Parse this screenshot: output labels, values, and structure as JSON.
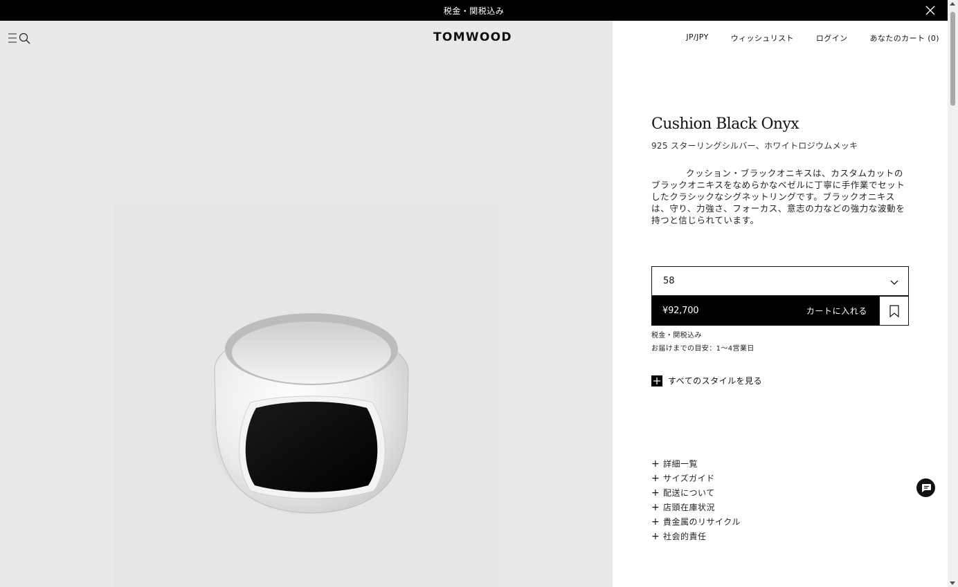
{
  "announcement": {
    "text": "税金・関税込み"
  },
  "header": {
    "logo": "TOMWOOD",
    "nav": {
      "region": "JP/JPY",
      "wishlist": "ウィッシュリスト",
      "login": "ログイン",
      "cart": "あなたのカート (0)"
    }
  },
  "product": {
    "title": "Cushion Black Onyx",
    "material": "925 スターリングシルバー、ホワイトロジウムメッキ",
    "description": "クッション・ブラックオニキスは、カスタムカットのブラックオニキスをなめらかなベゼルに丁寧に手作業でセットしたクラシックなシグネットリングです。ブラックオニキスは、守り、力強さ、フォーカス、意志の力などの強力な波動を持つと信じられています。",
    "size_selected": "58",
    "price": "¥92,700",
    "add_to_cart": "カートに入れる",
    "tax_note": "税金・関税込み",
    "delivery": "お届けまでの目安：1～4営業日",
    "see_all_styles": "すべてのスタイルを見る"
  },
  "accordion": [
    "詳細一覧",
    "サイズガイド",
    "配送について",
    "店頭在庫状況",
    "貴金属のリサイクル",
    "社会的責任"
  ],
  "icons": {
    "close": "close-icon",
    "menu": "menu-icon",
    "search": "search-icon",
    "chevron": "chevron-down-icon",
    "bookmark": "bookmark-icon",
    "plus": "plus-icon",
    "chat": "chat-icon"
  }
}
